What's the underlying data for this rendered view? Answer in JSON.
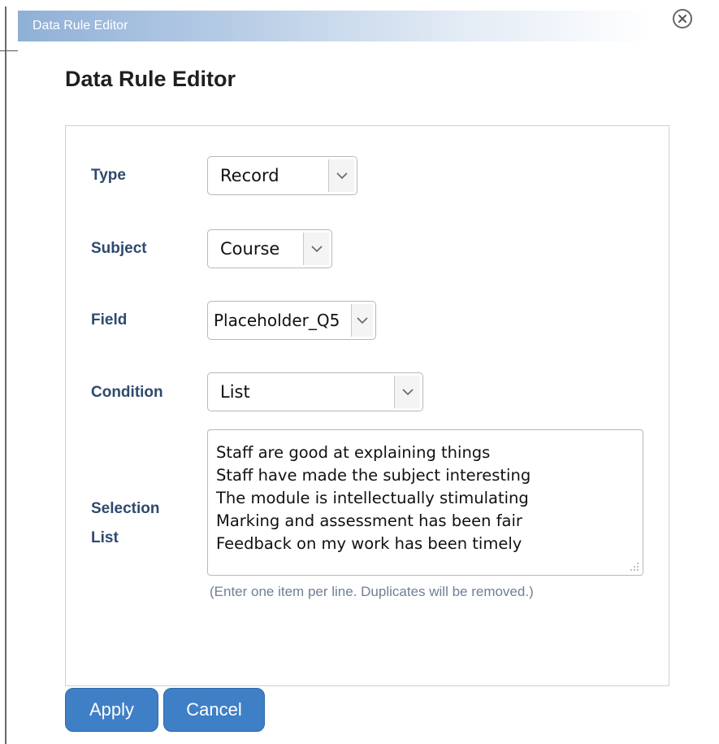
{
  "window": {
    "titlebar_text": "Data Rule Editor",
    "close_icon": "close-circle-icon"
  },
  "page": {
    "title": "Data Rule Editor"
  },
  "form": {
    "type": {
      "label": "Type",
      "value": "Record"
    },
    "subject": {
      "label": "Subject",
      "value": "Course"
    },
    "field": {
      "label": "Field",
      "value": "Placeholder_Q5"
    },
    "condition": {
      "label": "Condition",
      "value": "List"
    },
    "selection_list": {
      "label_line1": "Selection",
      "label_line2": "List",
      "items": [
        "Staff are good at explaining things",
        "Staff have made the subject interesting",
        "The module is intellectually stimulating",
        "Marking and assessment has been fair",
        "Feedback on my work has been timely"
      ],
      "hint": "(Enter one item per line. Duplicates will be removed.)"
    }
  },
  "actions": {
    "apply_label": "Apply",
    "cancel_label": "Cancel"
  },
  "colors": {
    "label": "#2e4a6e",
    "button": "#3f7fc6",
    "hint": "#6f7f95"
  }
}
